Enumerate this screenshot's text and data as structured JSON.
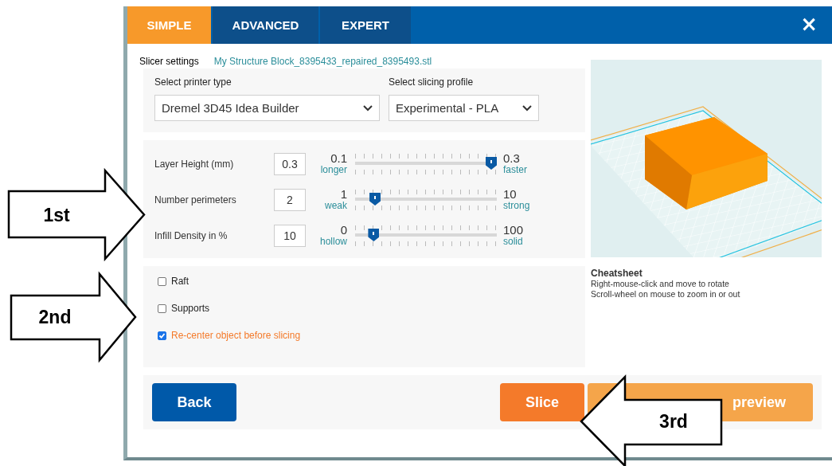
{
  "tabs": [
    {
      "label": "SIMPLE",
      "selected": true
    },
    {
      "label": "ADVANCED",
      "selected": false
    },
    {
      "label": "EXPERT",
      "selected": false
    }
  ],
  "close": "×",
  "slicer_settings": {
    "label": "Slicer settings",
    "file": "My Structure Block_8395433_repaired_8395493.stl"
  },
  "selects": [
    {
      "label": "Select printer type",
      "value": "Dremel 3D45 Idea Builder"
    },
    {
      "label": "Select slicing profile",
      "value": "Experimental - PLA"
    }
  ],
  "settings": [
    {
      "label": "Layer Height (mm)",
      "value": "0.3",
      "min": "0.1",
      "min_hint": "longer",
      "max": "0.3",
      "max_hint": "faster",
      "level": 1
    },
    {
      "label": "Number perimeters",
      "value": "2",
      "min": "1",
      "min_hint": "weak",
      "max": "10",
      "max_hint": "strong",
      "level": 0.11
    },
    {
      "label": "Infill Density in %",
      "value": "10",
      "min": "0",
      "min_hint": "hollow",
      "max": "100",
      "max_hint": "solid",
      "level": 0.1
    }
  ],
  "options": [
    {
      "label": "Raft",
      "checked": false
    },
    {
      "label": "Supports",
      "checked": false
    },
    {
      "label": "Re-center object before slicing",
      "checked": true
    }
  ],
  "cheatsheet": {
    "title": "Cheatsheet",
    "lines": [
      "Right-mouse-click and move to rotate",
      "Scroll-wheel on mouse to zoom in or out"
    ]
  },
  "buttons": [
    {
      "label": "Back",
      "kind": "back"
    },
    {
      "label": "Slice",
      "kind": "slice"
    },
    {
      "label": "preview",
      "kind": "preview"
    }
  ],
  "annotations": [
    {
      "label": "1st",
      "kind": "right-arrow"
    },
    {
      "label": "2nd",
      "kind": "right-arrow"
    },
    {
      "label": "3rd",
      "kind": "left-arrow"
    }
  ]
}
